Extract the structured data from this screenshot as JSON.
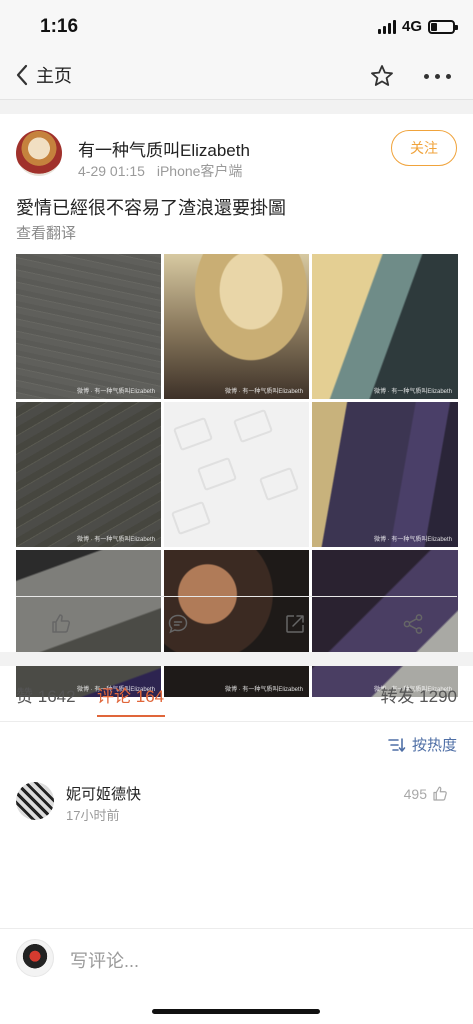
{
  "status_bar": {
    "time": "1:16",
    "network": "4G",
    "battery_level": 0.3
  },
  "nav": {
    "back_label": "主页",
    "icons": [
      "chevron-left-icon",
      "star-icon",
      "more-icon"
    ]
  },
  "post": {
    "author": "有一种气质叫Elizabeth",
    "timestamp": "4-29 01:15",
    "source": "iPhone客户端",
    "follow_label": "关注",
    "text": "愛情已經很不容易了渣浪還要掛圖",
    "translate_label": "查看翻译",
    "image_count": 9,
    "watermark": "微博 · 有一种气质叫Elizabeth"
  },
  "actions": [
    {
      "name": "like",
      "icon": "thumbs-up-icon"
    },
    {
      "name": "comment",
      "icon": "comment-icon"
    },
    {
      "name": "repost",
      "icon": "repost-icon"
    },
    {
      "name": "share",
      "icon": "share-icon"
    }
  ],
  "tabs": {
    "likes": {
      "label": "赞",
      "count": "1642"
    },
    "comments": {
      "label": "评论",
      "count": "164"
    },
    "reposts": {
      "label": "转发",
      "count": "1290"
    },
    "active": "comments"
  },
  "sort": {
    "label": "按热度",
    "icon": "sort-icon"
  },
  "comments": [
    {
      "user": "妮可姬德快",
      "time": "17小时前",
      "likes": "495"
    }
  ],
  "compose": {
    "placeholder": "写评论..."
  },
  "colors": {
    "accent": "#e0663a",
    "follow": "#f0a33b",
    "link": "#4f6fa6"
  }
}
